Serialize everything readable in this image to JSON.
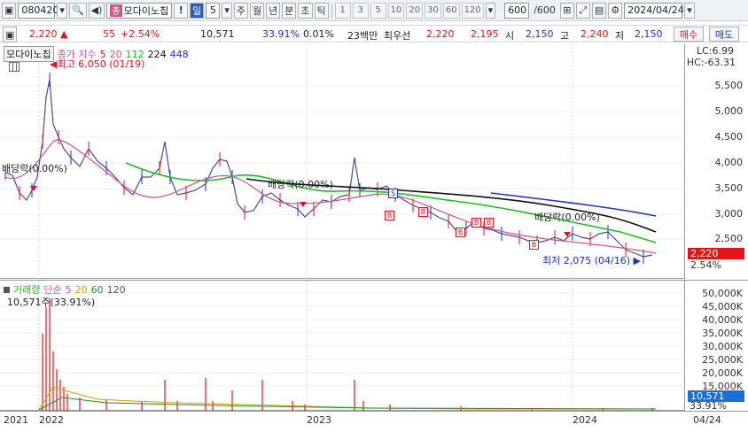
{
  "toolbar": {
    "code": "080420",
    "name": "모다이노칩",
    "name_badge": "종",
    "alert": "!",
    "period_selected": "일",
    "period_value": "5",
    "periods": [
      "주",
      "월",
      "년",
      "분",
      "초",
      "틱"
    ],
    "intervals": [
      "1",
      "3",
      "5",
      "10",
      "20",
      "30",
      "60",
      "120"
    ],
    "count": "600",
    "count_total": "/600",
    "date": "2024/04/24",
    "icons": [
      "window-icon",
      "search-icon",
      "sound-icon",
      "grid-icon",
      "compare-icon",
      "save-icon",
      "gear-icon"
    ]
  },
  "pricebar": {
    "price": "2,220",
    "direction": "▲",
    "change": "55",
    "change_pct": "+2.54%",
    "volume": "10,571",
    "volume_ratio": "33.91%",
    "turnover": "0.01%",
    "quote_label": "23백만",
    "bid_label": "최우선",
    "ask_price": "2,220",
    "bid_price": "2,195",
    "open_label": "시",
    "open": "2,150",
    "high_label": "고",
    "high": "2,240",
    "low_label": "저",
    "low": "2,150",
    "buy_btn": "매수",
    "sell_btn": "매도"
  },
  "price_panel": {
    "stock_label": "모다이노칩",
    "legend_title": "종가 지수",
    "ma_labels": [
      {
        "label": "5",
        "color": "#e0161a"
      },
      {
        "label": "20",
        "color": "#d4548a"
      },
      {
        "label": "112",
        "color": "#1fbf1f"
      },
      {
        "label": "224",
        "color": "#111111"
      },
      {
        "label": "448",
        "color": "#1a34c9"
      }
    ],
    "lc": "LC:6.99",
    "hc": "HC:-63.31",
    "ticks": [
      "5,500",
      "5,000",
      "4,500",
      "4,000",
      "3,500",
      "3,000",
      "2,500"
    ],
    "current_flag": "2,220",
    "current_pct": "2.54%",
    "high_note": "최고 6,050 (01/19)",
    "low_note": "최저 2,075 (04/16)",
    "dividend_notes": [
      "배당락(0.00%)",
      "배당락(0.00%)",
      "배당락(0.00%)"
    ],
    "buy_mark": "B",
    "sell_mark": "S"
  },
  "volume_panel": {
    "legend_title": "거래량",
    "legend_sub": "단순",
    "ma_labels": [
      {
        "label": "5",
        "color": "#d4548a"
      },
      {
        "label": "20",
        "color": "#d9a000"
      },
      {
        "label": "60",
        "color": "#1f8f1f"
      },
      {
        "label": "120",
        "color": "#555555"
      }
    ],
    "volume_note": "10,571주(33.91%)",
    "ticks": [
      "50,000K",
      "45,000K",
      "40,000K",
      "35,000K",
      "30,000K",
      "25,000K",
      "20,000K",
      "15,000K"
    ],
    "current_flag": "10,571",
    "current_pct": "33.91%"
  },
  "xaxis": {
    "labels": [
      "2021",
      "2022",
      "2023",
      "2024"
    ],
    "right_label": "04/24"
  }
}
